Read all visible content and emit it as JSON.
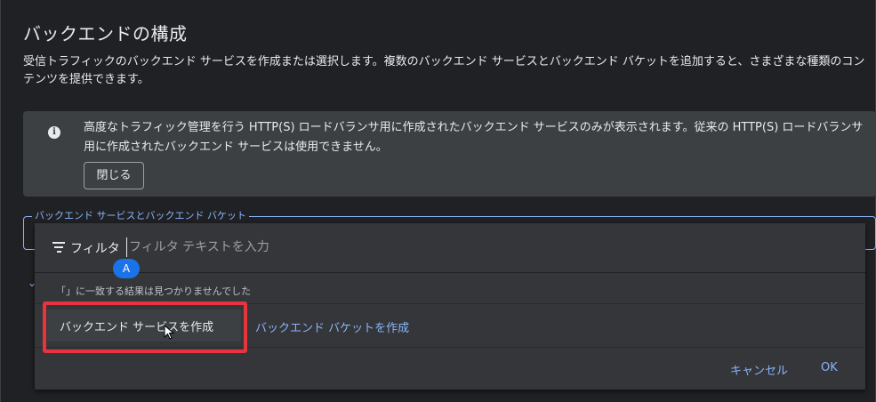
{
  "page": {
    "title": "バックエンドの構成",
    "description": "受信トラフィックのバックエンド サービスを作成または選択します。複数のバックエンド サービスとバックエンド バケットを追加すると、さまざまな種類のコンテンツを提供できます。"
  },
  "info_banner": {
    "icon": "info-icon",
    "text": "高度なトラフィック管理を行う HTTP(S) ロードバランサ用に作成されたバックエンド サービスのみが表示されます。従来の HTTP(S) ロードバランサ用に作成されたバックエンド サービスは使用できません。",
    "close_label": "閉じる"
  },
  "backend_field": {
    "label": "バックエンド サービスとバックエンド バケット"
  },
  "dropdown": {
    "filter_label": "フィルタ",
    "filter_placeholder": "フィルタ テキストを入力",
    "cursor_badge": "A",
    "no_results": "「」に一致する結果は見つかりませんでした",
    "create_service_label": "バックエンド サービスを作成",
    "create_bucket_label": "バックエンド バケットを作成",
    "cancel_label": "キャンセル",
    "ok_label": "OK"
  },
  "colors": {
    "accent": "#8ab4f8",
    "highlight": "#e8343f",
    "background": "#202124"
  }
}
